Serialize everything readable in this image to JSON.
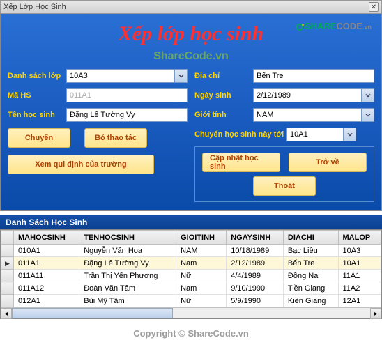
{
  "window": {
    "title": "Xếp Lớp Học Sinh"
  },
  "watermark": {
    "brand_a": "SHARE",
    "brand_b": "CODE",
    "tld": ".vn",
    "center": "ShareCode.vn",
    "copyright": "Copyright © ShareCode.vn"
  },
  "heading": "Xếp lớp học sinh",
  "labels": {
    "class_list": "Danh sách lớp",
    "student_id": "Mã HS",
    "student_name": "Tên học sinh",
    "address": "Địa chỉ",
    "birthday": "Ngày sinh",
    "gender": "Giới tính",
    "transfer_to": "Chuyển học sinh này tới"
  },
  "values": {
    "class": "10A3",
    "student_id": "011A1",
    "student_name": "Đặng Lê Tường Vy",
    "address": "Bến Tre",
    "birthday": "2/12/1989",
    "gender": "NAM",
    "transfer_to": "10A1"
  },
  "buttons": {
    "transfer": "Chuyển",
    "cancel_op": "Bỏ thao tác",
    "view_rules": "Xem qui định của trường",
    "update": "Cập nhật học sinh",
    "back": "Trở về",
    "exit": "Thoát"
  },
  "list_title": "Danh Sách Học Sinh",
  "grid": {
    "columns": [
      "MAHOCSINH",
      "TENHOCSINH",
      "GIOITINH",
      "NGAYSINH",
      "DIACHI",
      "MALOP"
    ],
    "rows": [
      {
        "id": "010A1",
        "name": "Nguyễn Văn Hoa",
        "gender": "NAM",
        "dob": "10/18/1989",
        "addr": "Bạc Liêu",
        "class": "10A3"
      },
      {
        "id": "011A1",
        "name": "Đặng Lê Tường Vy",
        "gender": "Nam",
        "dob": "2/12/1989",
        "addr": "Bến Tre",
        "class": "10A1"
      },
      {
        "id": "011A11",
        "name": "Trần Thị Yến Phương",
        "gender": "Nữ",
        "dob": "4/4/1989",
        "addr": "Đồng Nai",
        "class": "11A1"
      },
      {
        "id": "011A12",
        "name": "Đoàn Văn Tâm",
        "gender": "Nam",
        "dob": "9/10/1990",
        "addr": "Tiền Giang",
        "class": "11A2"
      },
      {
        "id": "012A1",
        "name": "Bùi Mỹ Tâm",
        "gender": "Nữ",
        "dob": "5/9/1990",
        "addr": "Kiên Giang",
        "class": "12A1"
      }
    ],
    "selected_index": 1
  }
}
